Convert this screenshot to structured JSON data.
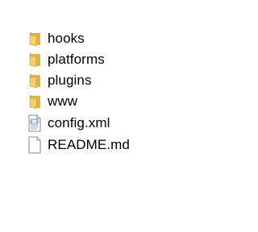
{
  "items": [
    {
      "name": "hooks",
      "type": "folder",
      "icon": "folder-icon"
    },
    {
      "name": "platforms",
      "type": "folder",
      "icon": "folder-icon"
    },
    {
      "name": "plugins",
      "type": "folder",
      "icon": "folder-icon"
    },
    {
      "name": "www",
      "type": "folder",
      "icon": "folder-icon"
    },
    {
      "name": "config.xml",
      "type": "file",
      "icon": "xml-file-icon"
    },
    {
      "name": "README.md",
      "type": "file",
      "icon": "blank-file-icon"
    }
  ],
  "colors": {
    "folder_back": "#e0b34a",
    "folder_front": "#f4cf6d",
    "folder_shade": "#c99a2e",
    "file_border": "#8a8a8a",
    "xml_badge": "#3b7bd1"
  }
}
